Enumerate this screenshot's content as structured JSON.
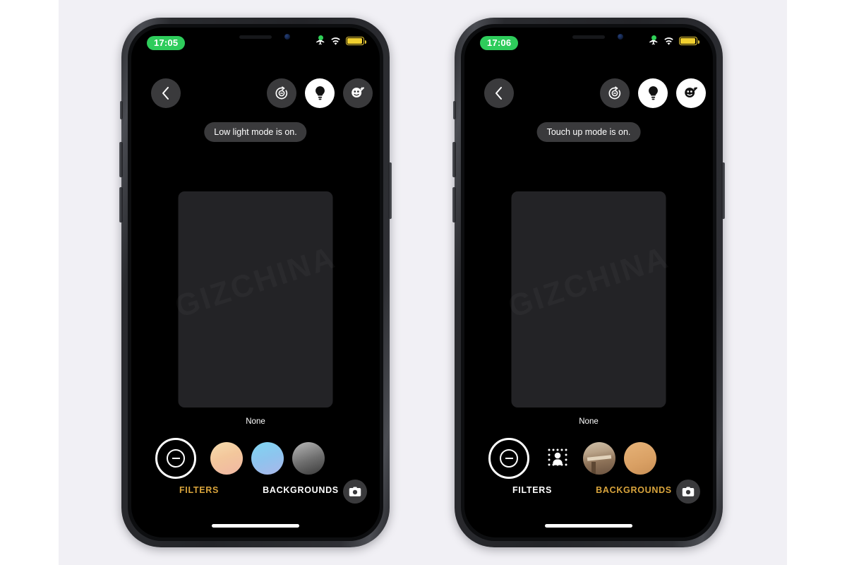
{
  "scene": {
    "background_color": "#f1f0f5",
    "outer_color": "#ffffff",
    "accent_color": "#d9a43c",
    "status_green": "#2ecc5b",
    "battery_yellow": "#f0cf2f"
  },
  "phones": [
    {
      "id": "phone-left",
      "status": {
        "time": "17:05",
        "icons": [
          "recording-dot",
          "airplane-mode-icon",
          "wifi-icon",
          "battery-low-power-icon"
        ]
      },
      "topbar": {
        "back_label": "‹",
        "buttons": [
          {
            "name": "timer-button",
            "icon": "timer-icon",
            "active": false
          },
          {
            "name": "low-light-button",
            "icon": "lightbulb-icon",
            "active": true
          },
          {
            "name": "touch-up-button",
            "icon": "touch-up-face-icon",
            "active": false
          }
        ]
      },
      "toast": "Low light mode is on.",
      "selector": {
        "label": "None",
        "items": [
          {
            "name": "filter-none",
            "kind": "none",
            "selected": true
          },
          {
            "name": "filter-warm",
            "kind": "swatch-warm"
          },
          {
            "name": "filter-cool",
            "kind": "swatch-cool"
          },
          {
            "name": "filter-mono",
            "kind": "swatch-mono"
          }
        ]
      },
      "tabs": [
        {
          "label": "FILTERS",
          "active": true
        },
        {
          "label": "BACKGROUNDS",
          "active": false
        }
      ],
      "shutter_icon": "camera-icon"
    },
    {
      "id": "phone-right",
      "status": {
        "time": "17:06",
        "icons": [
          "recording-dot",
          "airplane-mode-icon",
          "wifi-icon",
          "battery-low-power-icon"
        ]
      },
      "topbar": {
        "back_label": "‹",
        "buttons": [
          {
            "name": "timer-button",
            "icon": "timer-icon",
            "active": false
          },
          {
            "name": "low-light-button",
            "icon": "lightbulb-icon",
            "active": true
          },
          {
            "name": "touch-up-button",
            "icon": "touch-up-face-icon",
            "active": true
          }
        ]
      },
      "toast": "Touch up mode is on.",
      "selector": {
        "label": "None",
        "items": [
          {
            "name": "background-none",
            "kind": "none",
            "selected": true
          },
          {
            "name": "background-blur-person",
            "kind": "blur-person"
          },
          {
            "name": "background-room",
            "kind": "photo-room"
          },
          {
            "name": "background-tan",
            "kind": "swatch-tan"
          }
        ]
      },
      "tabs": [
        {
          "label": "FILTERS",
          "active": false
        },
        {
          "label": "BACKGROUNDS",
          "active": true
        }
      ],
      "shutter_icon": "camera-icon"
    }
  ],
  "watermark": "GIZCHINA"
}
